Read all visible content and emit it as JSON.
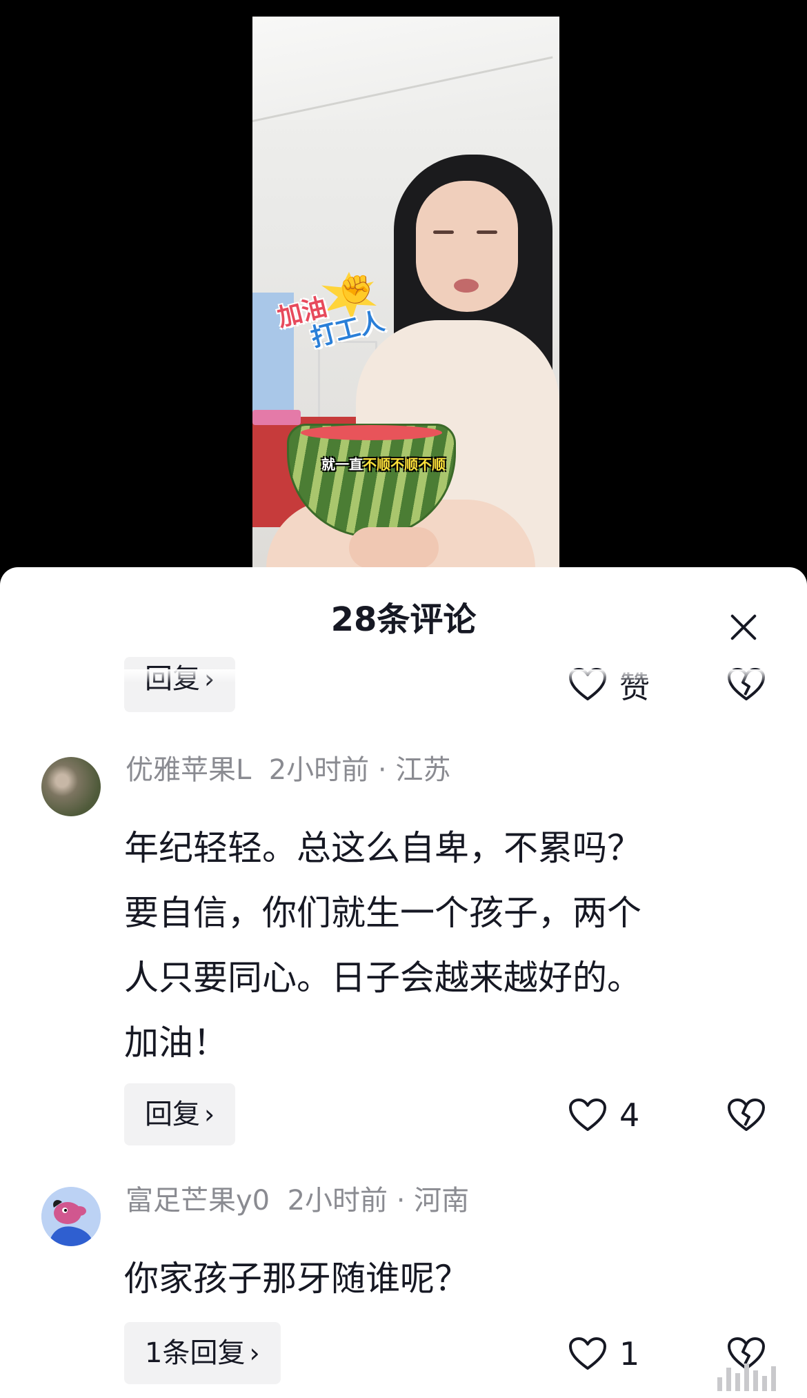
{
  "video": {
    "sticker_line1": "加油",
    "sticker_line2": "打工人",
    "caption_prefix": "就一直",
    "caption_highlight": "不顺不顺不顺"
  },
  "sheet": {
    "title": "28条评论"
  },
  "comments": [
    {
      "reply_label": "回复",
      "like_label": "赞"
    },
    {
      "username": "优雅苹果L",
      "time": "2小时前",
      "location": "江苏",
      "lines": [
        "年纪轻轻。总这么自卑，不累吗？",
        "要自信，你们就生一个孩子，两个",
        "人只要同心。日子会越来越好的。",
        "加油！"
      ],
      "reply_label": "回复",
      "like_count": "4"
    },
    {
      "username": "富足芒果y0",
      "time": "2小时前",
      "location": "河南",
      "lines": [
        "你家孩子那牙随谁呢？"
      ],
      "reply_label": "1条回复",
      "like_count": "1"
    }
  ]
}
